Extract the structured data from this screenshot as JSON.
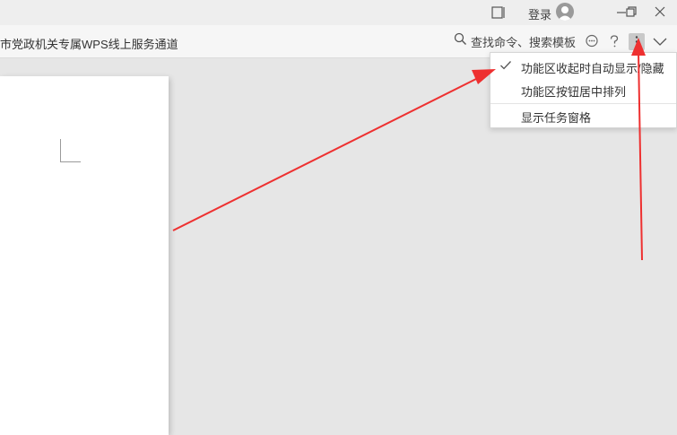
{
  "titlebar": {
    "login_label": "登录",
    "icons": [
      "reading-mode-icon",
      "avatar-icon",
      "minimize-icon",
      "restore-icon",
      "close-icon"
    ]
  },
  "toolbar": {
    "notice_link": "市党政机关专属WPS线上服务通道",
    "search_label": "查找命令、搜索模板",
    "icons": [
      "search-icon",
      "feedback-icon",
      "help-icon",
      "more-icon",
      "collapse-icon"
    ]
  },
  "menu": {
    "items": [
      {
        "label": "功能区收起时自动显示/隐藏",
        "checked": true
      },
      {
        "label": "功能区按钮居中排列",
        "checked": false
      },
      {
        "label": "显示任务窗格",
        "checked": false
      }
    ]
  },
  "colors": {
    "workspace": "#e6e6e6",
    "annotation_arrow": "#ee3030"
  }
}
